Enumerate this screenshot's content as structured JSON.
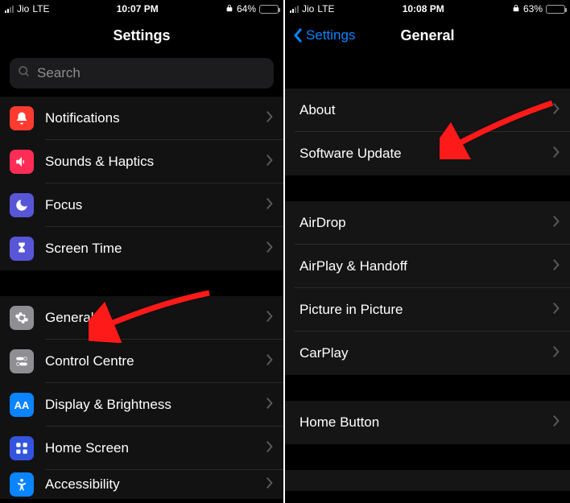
{
  "colors": {
    "accent": "#0a84ff",
    "arrow": "#ff1a1a",
    "notifications": "#ff3b30",
    "sounds": "#ff2d55",
    "focus": "#5856d6",
    "screentime": "#5856d6",
    "general": "#8e8e93",
    "controlcentre": "#8e8e93",
    "display": "#0a84ff",
    "homescreen": "#3355dd",
    "accessibility": "#0a84ff"
  },
  "left": {
    "status": {
      "carrier": "Jio",
      "net": "LTE",
      "time": "10:07 PM",
      "battery_pct": "64%",
      "battery_fill": 64,
      "signal": 2
    },
    "title": "Settings",
    "search_placeholder": "Search",
    "groups": [
      [
        {
          "label": "Notifications",
          "icon": "bell",
          "color": "notifications"
        },
        {
          "label": "Sounds & Haptics",
          "icon": "speaker",
          "color": "sounds"
        },
        {
          "label": "Focus",
          "icon": "moon",
          "color": "focus"
        },
        {
          "label": "Screen Time",
          "icon": "hourglass",
          "color": "screentime"
        }
      ],
      [
        {
          "label": "General",
          "icon": "gear",
          "color": "general"
        },
        {
          "label": "Control Centre",
          "icon": "toggles",
          "color": "controlcentre"
        },
        {
          "label": "Display & Brightness",
          "icon": "aa",
          "color": "display"
        },
        {
          "label": "Home Screen",
          "icon": "grid",
          "color": "homescreen"
        },
        {
          "label": "Accessibility",
          "icon": "person",
          "color": "accessibility"
        }
      ]
    ]
  },
  "right": {
    "status": {
      "carrier": "Jio",
      "net": "LTE",
      "time": "10:08 PM",
      "battery_pct": "63%",
      "battery_fill": 63,
      "signal": 2
    },
    "back_label": "Settings",
    "title": "General",
    "groups": [
      [
        {
          "label": "About"
        },
        {
          "label": "Software Update"
        }
      ],
      [
        {
          "label": "AirDrop"
        },
        {
          "label": "AirPlay & Handoff"
        },
        {
          "label": "Picture in Picture"
        },
        {
          "label": "CarPlay"
        }
      ],
      [
        {
          "label": "Home Button"
        }
      ],
      [
        {
          "label": ""
        }
      ]
    ]
  }
}
